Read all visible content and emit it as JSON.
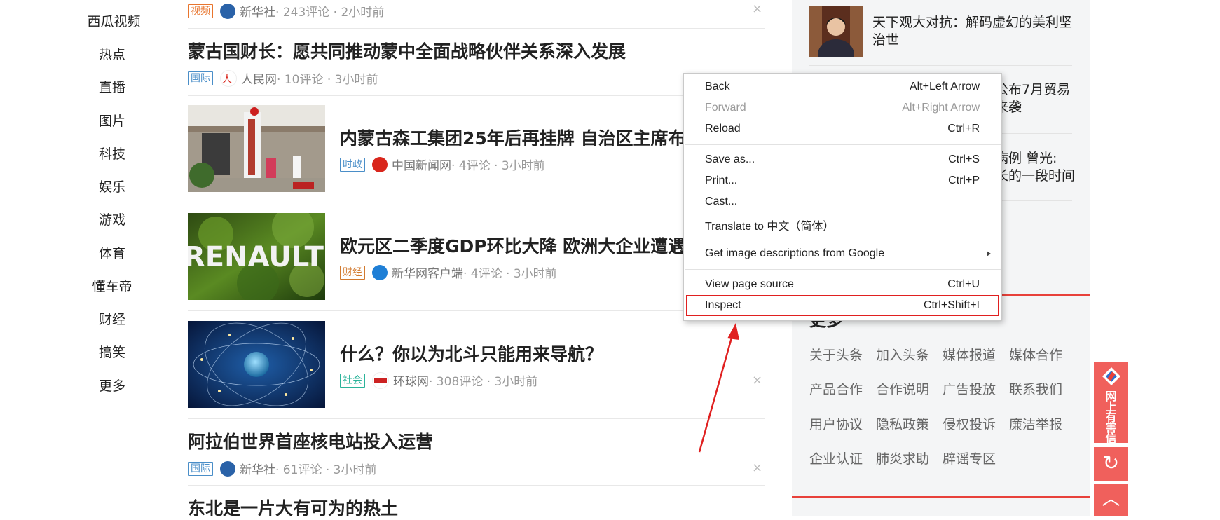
{
  "nav": [
    "西瓜视频",
    "热点",
    "直播",
    "图片",
    "科技",
    "娱乐",
    "游戏",
    "体育",
    "懂车帝",
    "财经",
    "搞笑",
    "更多"
  ],
  "feed": [
    {
      "tag": "视频",
      "tag_style": "video",
      "source": "新华社",
      "meta": " · 243评论 · 2小时前",
      "avatar_color": "#2a62a8"
    },
    {
      "title": "蒙古国财长：愿共同推动蒙中全面战略伙伴关系深入发展",
      "tag": "国际",
      "tag_style": "intl",
      "source": "人民网",
      "meta": " · 10评论 · 3小时前",
      "avatar_color": "#d9261c"
    },
    {
      "title": "内蒙古森工集团25年后再挂牌 自治区主席布",
      "tag": "时政",
      "tag_style": "pol",
      "source": "中国新闻网",
      "meta": " · 4评论 · 3小时前",
      "avatar_color": "#d9261c"
    },
    {
      "title": "欧元区二季度GDP环比大降 欧洲大企业遭遇",
      "tag": "财经",
      "tag_style": "fin",
      "source": "新华网客户端",
      "meta": " · 4评论 · 3小时前",
      "avatar_color": "#1f7fd6",
      "thumb_text": "RENAULT"
    },
    {
      "title": "什么？你以为北斗只能用来导航？",
      "tag": "社会",
      "tag_style": "soc",
      "source": "环球网",
      "meta": " · 308评论 · 3小时前",
      "avatar_color": "#cc2222"
    },
    {
      "title": "阿拉伯世界首座核电站投入运营",
      "tag": "国际",
      "tag_style": "intl",
      "source": "新华社",
      "meta": " · 61评论 · 3小时前",
      "avatar_color": "#2a62a8"
    },
    {
      "title": "东北是一片大有可为的热土"
    }
  ],
  "close_symbol": "×",
  "right": {
    "item1": "天下观大对抗：解码虚幻的美利坚治世",
    "item2_part": "公布7月贸易\n来袭",
    "item3_part": "病例 曾光:\n长的一段时间",
    "more_heading": "更多",
    "links": [
      [
        "关于头条",
        "加入头条",
        "媒体报道",
        "媒体合作"
      ],
      [
        "产品合作",
        "合作说明",
        "广告投放",
        "联系我们"
      ],
      [
        "用户协议",
        "隐私政策",
        "侵权投诉",
        "廉洁举报"
      ],
      [
        "企业认证",
        "肺炎求助",
        "辟谣专区"
      ]
    ]
  },
  "float": {
    "report": "网上有害信息举报",
    "refresh_icon": "↻",
    "top_icon": "︿"
  },
  "menu": [
    {
      "label": "Back",
      "shortcut": "Alt+Left Arrow",
      "disabled": false
    },
    {
      "label": "Forward",
      "shortcut": "Alt+Right Arrow",
      "disabled": true
    },
    {
      "label": "Reload",
      "shortcut": "Ctrl+R",
      "disabled": false
    },
    {
      "label": "Save as...",
      "shortcut": "Ctrl+S",
      "disabled": false
    },
    {
      "label": "Print...",
      "shortcut": "Ctrl+P",
      "disabled": false
    },
    {
      "label": "Cast...",
      "shortcut": "",
      "disabled": false
    },
    {
      "label": "Translate to 中文（简体）",
      "shortcut": "",
      "disabled": false
    },
    {
      "label": "Get image descriptions from Google",
      "shortcut": "",
      "submenu": true,
      "disabled": false
    },
    {
      "label": "View page source",
      "shortcut": "Ctrl+U",
      "disabled": false
    },
    {
      "label": "Inspect",
      "shortcut": "Ctrl+Shift+I",
      "disabled": false,
      "highlighted": true
    }
  ],
  "colors": {
    "accent_red": "#e8413a",
    "annotation_red": "#e02020"
  }
}
